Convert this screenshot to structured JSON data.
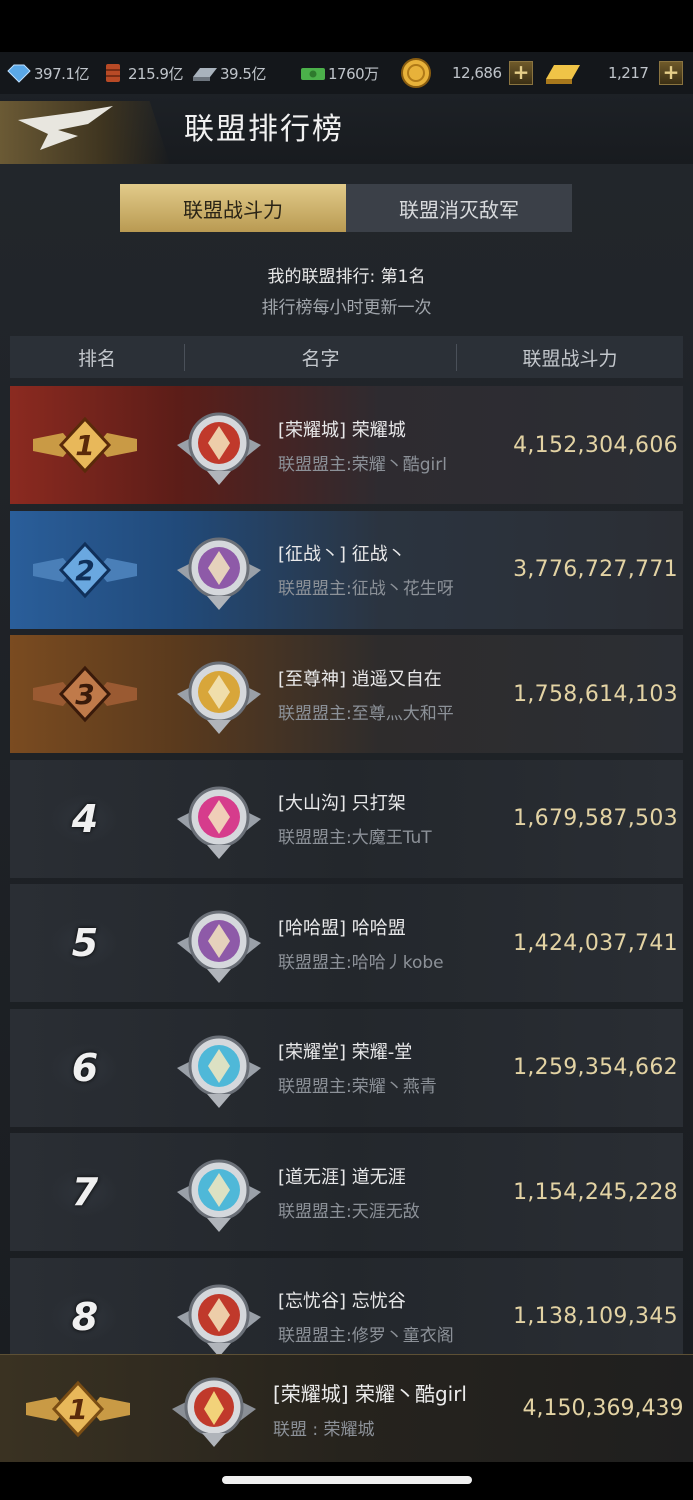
{
  "resources": [
    {
      "icon": "crystal-icon",
      "value": "397.1亿",
      "color": "#5aa8e8"
    },
    {
      "icon": "oil-barrel-icon",
      "value": "215.9亿",
      "color": "#c0552e"
    },
    {
      "icon": "steel-bar-icon",
      "value": "39.5亿",
      "color": "#a9b3bd"
    },
    {
      "icon": "cash-icon",
      "value": "1760万",
      "color": "#4bb04a"
    },
    {
      "icon": "gold-coin-icon",
      "value": "12,686",
      "color": "#e8b23a"
    },
    {
      "icon": "gold-bar-icon",
      "value": "1,217",
      "color": "#e8b23a"
    }
  ],
  "header": {
    "title": "联盟排行榜"
  },
  "tabs": [
    {
      "label": "联盟战斗力",
      "active": true
    },
    {
      "label": "联盟消灭敌军",
      "active": false
    }
  ],
  "my_rank_text": "我的联盟排行: 第1名",
  "update_note": "排行榜每小时更新一次",
  "columns": {
    "rank": "排名",
    "name": "名字",
    "power": "联盟战斗力"
  },
  "rows": [
    {
      "rank": "1",
      "name": "[荣耀城] 荣耀城",
      "leader": "联盟盟主:荣耀丶酷girl",
      "power": "4,152,304,606",
      "emblem_color": "#c0392b"
    },
    {
      "rank": "2",
      "name": "[征战丶] 征战丶",
      "leader": "联盟盟主:征战丶花生呀",
      "power": "3,776,727,771",
      "emblem_color": "#8e5aa8"
    },
    {
      "rank": "3",
      "name": "[至尊神] 逍遥又自在",
      "leader": "联盟盟主:至尊灬大和平",
      "power": "1,758,614,103",
      "emblem_color": "#d8a63a"
    },
    {
      "rank": "4",
      "name": "[大山沟] 只打架",
      "leader": "联盟盟主:大魔王TuT",
      "power": "1,679,587,503",
      "emblem_color": "#d63c8c"
    },
    {
      "rank": "5",
      "name": "[哈哈盟] 哈哈盟",
      "leader": "联盟盟主:哈哈丿kobe",
      "power": "1,424,037,741",
      "emblem_color": "#8e5aa8"
    },
    {
      "rank": "6",
      "name": "[荣耀堂] 荣耀-堂",
      "leader": "联盟盟主:荣耀丶燕青",
      "power": "1,259,354,662",
      "emblem_color": "#4fb8d8"
    },
    {
      "rank": "7",
      "name": "[道无涯] 道无涯",
      "leader": "联盟盟主:天涯无敌",
      "power": "1,154,245,228",
      "emblem_color": "#4fb8d8"
    },
    {
      "rank": "8",
      "name": "[忘忧谷] 忘忧谷",
      "leader": "联盟盟主:修罗丶童衣阁",
      "power": "1,138,109,345",
      "emblem_color": "#c0392b"
    }
  ],
  "my_alliance": {
    "rank": "1",
    "name": "[荣耀城] 荣耀丶酷girl",
    "alliance": "联盟 : 荣耀城",
    "power": "4,150,369,439"
  }
}
